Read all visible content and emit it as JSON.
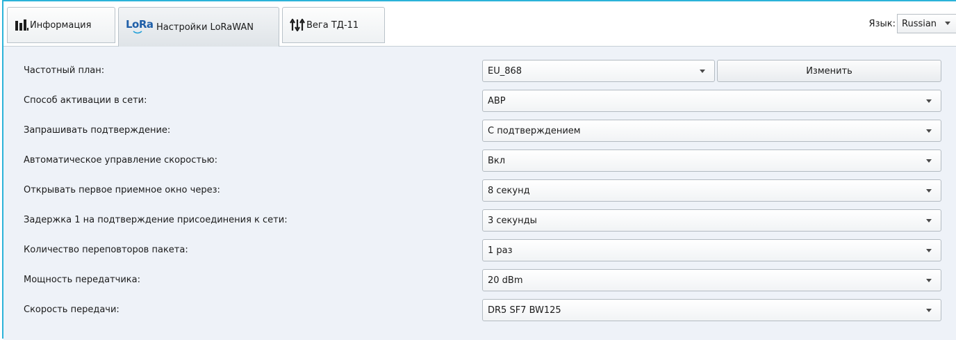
{
  "tabs": [
    {
      "label": "Информация",
      "icon": "bar-chart-icon",
      "active": false
    },
    {
      "label": "Настройки LoRaWAN",
      "icon": "lora-icon",
      "icon_text": "LoRa",
      "active": true
    },
    {
      "label": "Вега ТД-11",
      "icon": "arrows-updown-icon",
      "active": false
    }
  ],
  "language": {
    "label": "Язык:",
    "value": "Russian"
  },
  "settings": {
    "freq_plan": {
      "label": "Частотный план:",
      "value": "EU_868",
      "button": "Изменить"
    },
    "activation": {
      "label": "Способ активации в сети:",
      "value": "ABP"
    },
    "confirm": {
      "label": "Запрашивать подтверждение:",
      "value": "С подтверждением"
    },
    "adr": {
      "label": "Автоматическое управление скоростью:",
      "value": "Вкл"
    },
    "rx1": {
      "label": "Открывать первое приемное окно через:",
      "value": "8 секунд"
    },
    "join_delay": {
      "label": "Задержка 1 на подтверждение присоединения к сети:",
      "value": "3 секунды"
    },
    "retries": {
      "label": "Количество переповторов пакета:",
      "value": "1 раз"
    },
    "tx_power": {
      "label": "Мощность передатчика:",
      "value": "20 dBm"
    },
    "data_rate": {
      "label": "Скорость передачи:",
      "value": "DR5 SF7 BW125"
    }
  },
  "colors": {
    "accent_border": "#2bb3d9",
    "content_bg": "#eef2f8",
    "lora_blue": "#1f5fa8"
  }
}
